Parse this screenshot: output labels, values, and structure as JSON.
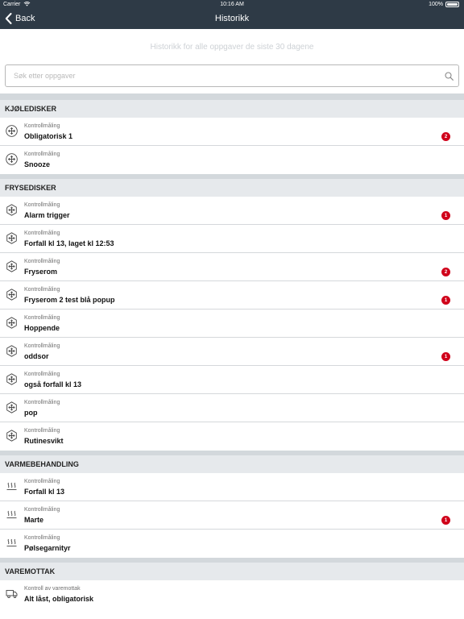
{
  "status_bar": {
    "carrier": "Carrier",
    "time": "10:16 AM",
    "battery": "100%"
  },
  "nav": {
    "back_label": "Back",
    "title": "Historikk"
  },
  "subtitle": "Historikk for alle oppgaver de siste 30 dagene",
  "search": {
    "placeholder": "Søk etter oppgaver",
    "value": ""
  },
  "colors": {
    "nav_bg": "#2e3a46",
    "badge": "#d0021b",
    "section_bg": "#e6e9ec"
  },
  "sections": [
    {
      "title": "KJØLEDISKER",
      "icon": "snowflake-icon",
      "items": [
        {
          "type": "Kontrollmåling",
          "title": "Obligatorisk 1",
          "badge": "2"
        },
        {
          "type": "Kontrollmåling",
          "title": "Snooze",
          "badge": ""
        }
      ]
    },
    {
      "title": "FRYSEDISKER",
      "icon": "freezer-icon",
      "items": [
        {
          "type": "Kontrollmåling",
          "title": "Alarm trigger",
          "badge": "1"
        },
        {
          "type": "Kontrollmåling",
          "title": "Forfall kl 13, laget kl 12:53",
          "badge": ""
        },
        {
          "type": "Kontrollmåling",
          "title": "Fryserom",
          "badge": "2"
        },
        {
          "type": "Kontrollmåling",
          "title": "Fryserom 2 test blå popup",
          "badge": "1"
        },
        {
          "type": "Kontrollmåling",
          "title": "Hoppende",
          "badge": ""
        },
        {
          "type": "Kontrollmåling",
          "title": "oddsor",
          "badge": "1"
        },
        {
          "type": "Kontrollmåling",
          "title": "også forfall kl 13",
          "badge": ""
        },
        {
          "type": "Kontrollmåling",
          "title": "pop",
          "badge": ""
        },
        {
          "type": "Kontrollmåling",
          "title": "Rutinesvikt",
          "badge": ""
        }
      ]
    },
    {
      "title": "VARMEBEHANDLING",
      "icon": "heat-icon",
      "items": [
        {
          "type": "Kontrollmåling",
          "title": "Forfall kl 13",
          "badge": ""
        },
        {
          "type": "Kontrollmåling",
          "title": "Marte",
          "badge": "1"
        },
        {
          "type": "Kontrollmåling",
          "title": "Pølsegarnityr",
          "badge": ""
        }
      ]
    },
    {
      "title": "VAREMOTTAK",
      "icon": "truck-icon",
      "items": [
        {
          "type": "Kontroll av varemottak",
          "title": "Alt låst, obligatorisk",
          "badge": ""
        }
      ]
    }
  ]
}
